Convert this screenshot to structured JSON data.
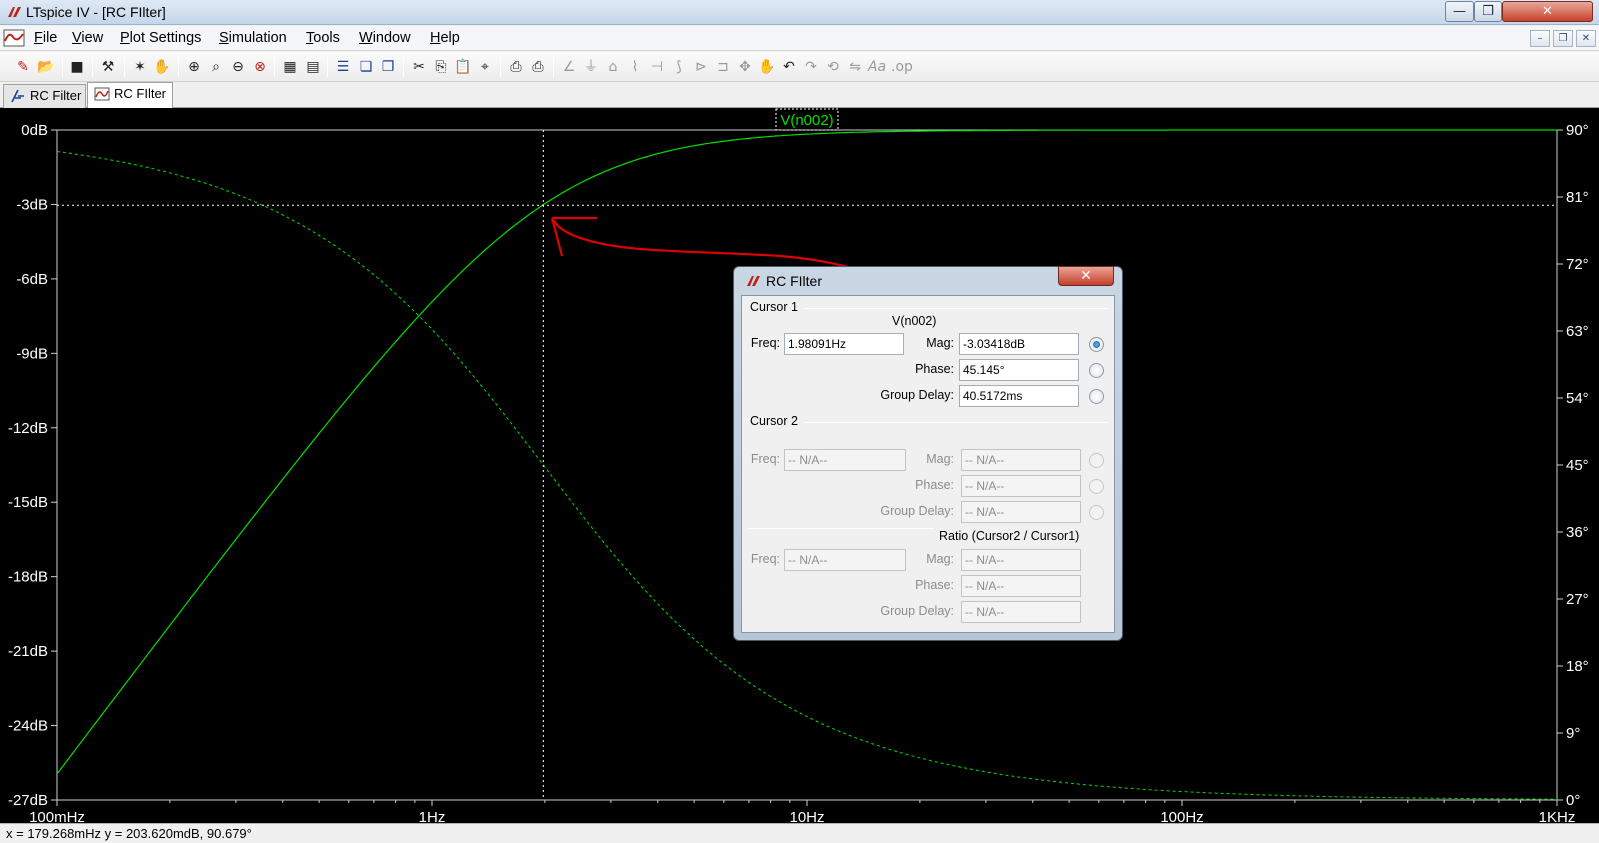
{
  "window": {
    "title": "LTspice IV - [RC FIlter]",
    "controls": {
      "minimize": "—",
      "maximize": "❐",
      "close": "✕"
    }
  },
  "menu": {
    "items": [
      "File",
      "View",
      "Plot Settings",
      "Simulation",
      "Tools",
      "Window",
      "Help"
    ],
    "mdi": {
      "minimize": "–",
      "restore": "❐",
      "close": "✕"
    }
  },
  "toolbar": {
    "icons": [
      "new-schematic-icon",
      "open-icon",
      "save-icon",
      "control-panel-icon",
      "run-icon",
      "pan-icon",
      "zoom-in-icon",
      "zoom-area-icon",
      "zoom-out-icon",
      "zoom-fit-icon",
      "autorange-icon",
      "autoscale-icon",
      "tile-horizontal-icon",
      "cascade-icon",
      "tile-vertical-icon",
      "cut-icon",
      "copy-icon",
      "paste-icon",
      "find-icon",
      "print-preview-icon",
      "print-icon",
      "wire-icon",
      "ground-icon",
      "label-icon",
      "resistor-icon",
      "capacitor-icon",
      "inductor-icon",
      "diode-icon",
      "component-icon",
      "move-icon",
      "drag-icon",
      "undo-icon",
      "redo-icon",
      "rotate-icon",
      "mirror-icon",
      "text-icon",
      "spice-directive-icon"
    ]
  },
  "tabs": [
    {
      "label": "RC Filter",
      "icon": "schematic-icon",
      "active": false
    },
    {
      "label": "RC FIlter",
      "icon": "waveform-icon",
      "active": true
    }
  ],
  "plot": {
    "trace_label": "V(n002)",
    "status": "x = 179.268mHz    y = 203.620mdB, 90.679°"
  },
  "chart_data": {
    "type": "line",
    "title": "V(n002)",
    "xscale": "log",
    "xlim": [
      0.1,
      1000
    ],
    "x_ticks": [
      "100mHz",
      "1Hz",
      "10Hz",
      "100Hz",
      "1KHz"
    ],
    "y_left_ticks": [
      "0dB",
      "-3dB",
      "-6dB",
      "-9dB",
      "-12dB",
      "-15dB",
      "-18dB",
      "-21dB",
      "-24dB",
      "-27dB"
    ],
    "y_right_ticks": [
      "90°",
      "81°",
      "72°",
      "63°",
      "54°",
      "45°",
      "36°",
      "27°",
      "18°",
      "9°",
      "0°"
    ],
    "ylim_left": [
      -27,
      0
    ],
    "ylim_right": [
      0,
      90
    ],
    "cutoff_hz": 1.98091,
    "series": [
      {
        "name": "V(n002)",
        "quantity": "magnitude (dB)",
        "style": "solid",
        "color": "#00e000"
      },
      {
        "name": "V(n002)",
        "quantity": "phase (deg)",
        "style": "dashed",
        "color": "#00e000"
      }
    ],
    "cursor": {
      "x": 1.98091,
      "y_db": -3.03418
    },
    "annotation": "red hand-drawn arrow from Mag field to cursor intersection"
  },
  "dialog": {
    "title": "RC FIlter",
    "close": "✕",
    "cursor1": {
      "label": "Cursor 1",
      "trace": "V(n002)",
      "freq_label": "Freq:",
      "freq": "1.98091Hz",
      "mag_label": "Mag:",
      "mag": "-3.03418dB",
      "phase_label": "Phase:",
      "phase": "45.145°",
      "gd_label": "Group Delay:",
      "gd": "40.5172ms"
    },
    "cursor2": {
      "label": "Cursor 2",
      "freq_label": "Freq:",
      "freq": "-- N/A--",
      "mag_label": "Mag:",
      "mag": "-- N/A--",
      "phase_label": "Phase:",
      "phase": "-- N/A--",
      "gd_label": "Group Delay:",
      "gd": "-- N/A--"
    },
    "ratio": {
      "label": "Ratio (Cursor2 / Cursor1)",
      "freq_label": "Freq:",
      "freq": "-- N/A--",
      "mag_label": "Mag:",
      "mag": "-- N/A--",
      "phase_label": "Phase:",
      "phase": "-- N/A--",
      "gd_label": "Group Delay:",
      "gd": "-- N/A--"
    }
  },
  "colors": {
    "plot_bg": "#000000",
    "trace": "#00e000",
    "annotation": "#e00000",
    "axis_text": "#ffffff"
  }
}
